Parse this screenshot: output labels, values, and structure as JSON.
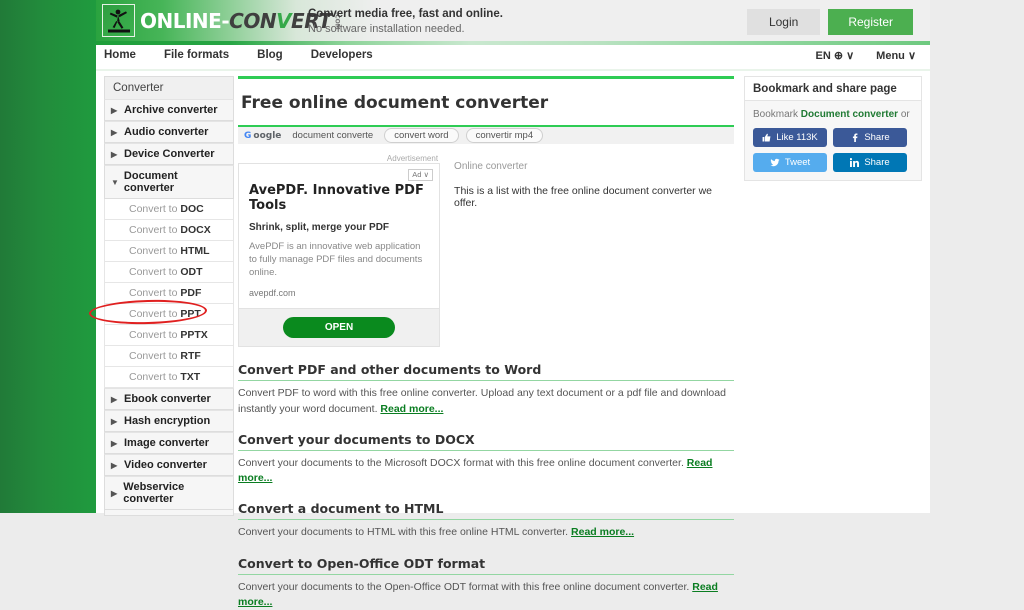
{
  "header": {
    "logo_text_parts": {
      "on": "ONLINE",
      "dash": "-",
      "con": "CON",
      "v": "V",
      "ert": "ERT",
      "com": ".COM"
    },
    "tagline_1": "Convert media free, fast and online.",
    "tagline_2": "No software installation needed.",
    "login_label": "Login",
    "register_label": "Register"
  },
  "nav": {
    "items": [
      {
        "label": "Home"
      },
      {
        "label": "File formats"
      },
      {
        "label": "Blog"
      },
      {
        "label": "Developers"
      }
    ],
    "language": "EN ⊕ ∨",
    "menu": "Menu ∨"
  },
  "sidebar": {
    "title": "Converter",
    "items": [
      {
        "label": "Archive converter",
        "arrow": "▶",
        "expanded": false
      },
      {
        "label": "Audio converter",
        "arrow": "▶",
        "expanded": false
      },
      {
        "label": "Device Converter",
        "arrow": "▶",
        "expanded": false
      },
      {
        "label": "Document converter",
        "arrow": "▼",
        "expanded": true
      }
    ],
    "sub_items": [
      {
        "prefix": "Convert to ",
        "format": "DOC"
      },
      {
        "prefix": "Convert to ",
        "format": "DOCX"
      },
      {
        "prefix": "Convert to ",
        "format": "HTML"
      },
      {
        "prefix": "Convert to ",
        "format": "ODT"
      },
      {
        "prefix": "Convert to ",
        "format": "PDF"
      },
      {
        "prefix": "Convert to ",
        "format": "PPT",
        "highlighted": true
      },
      {
        "prefix": "Convert to ",
        "format": "PPTX"
      },
      {
        "prefix": "Convert to ",
        "format": "RTF"
      },
      {
        "prefix": "Convert to ",
        "format": "TXT"
      }
    ],
    "items_after": [
      {
        "label": "Ebook converter",
        "arrow": "▶"
      },
      {
        "label": "Hash encryption",
        "arrow": "▶"
      },
      {
        "label": "Image converter",
        "arrow": "▶"
      },
      {
        "label": "Video converter",
        "arrow": "▶"
      },
      {
        "label": "Webservice converter",
        "arrow": "▶"
      }
    ],
    "highlight_color": "#e02020"
  },
  "main": {
    "page_title": "Free online document converter",
    "search": {
      "brand_g": "G",
      "brand_rest": "oogle",
      "pills": [
        {
          "label": "document converte"
        },
        {
          "label": "convert word"
        },
        {
          "label": "convertir mp4"
        }
      ]
    },
    "ad": {
      "label": "Advertisement",
      "badge": "Ad ∨",
      "title": "AvePDF. Innovative PDF Tools",
      "subtitle": "Shrink, split, merge your PDF",
      "body": "AvePDF is an innovative web application to fully manage PDF files and documents online.",
      "url": "avepdf.com",
      "cta": "OPEN"
    },
    "intro": {
      "kicker": "Online converter",
      "text": "This is a list with the free online document converter we offer."
    },
    "sections": [
      {
        "heading": "Convert PDF and other documents to Word",
        "body": "Convert PDF to word with this free online converter. Upload any text document or a pdf file and download instantly your word document. ",
        "read_more": "Read more..."
      },
      {
        "heading": "Convert your documents to DOCX",
        "body": "Convert your documents to the Microsoft DOCX format with this free online document converter. ",
        "read_more": "Read more..."
      },
      {
        "heading": "Convert a document to HTML",
        "body": "Convert your documents to HTML with this free online HTML converter. ",
        "read_more": "Read more..."
      },
      {
        "heading": "Convert to Open-Office ODT format",
        "body": "Convert your documents to the Open-Office ODT format with this free online document converter. ",
        "read_more": "Read more..."
      }
    ]
  },
  "right_column": {
    "title": "Bookmark and share page",
    "bookmark_prefix": "Bookmark ",
    "bookmark_link": "Document converter",
    "bookmark_suffix": " or",
    "share_buttons": [
      {
        "label": "Like 113K",
        "network": "facebook-like",
        "color": "#3b5998"
      },
      {
        "label": "Share",
        "network": "facebook-share",
        "color": "#3b5998"
      },
      {
        "label": "Tweet",
        "network": "twitter",
        "color": "#55acee"
      },
      {
        "label": "Share",
        "network": "linkedin",
        "color": "#0077b5"
      }
    ]
  }
}
